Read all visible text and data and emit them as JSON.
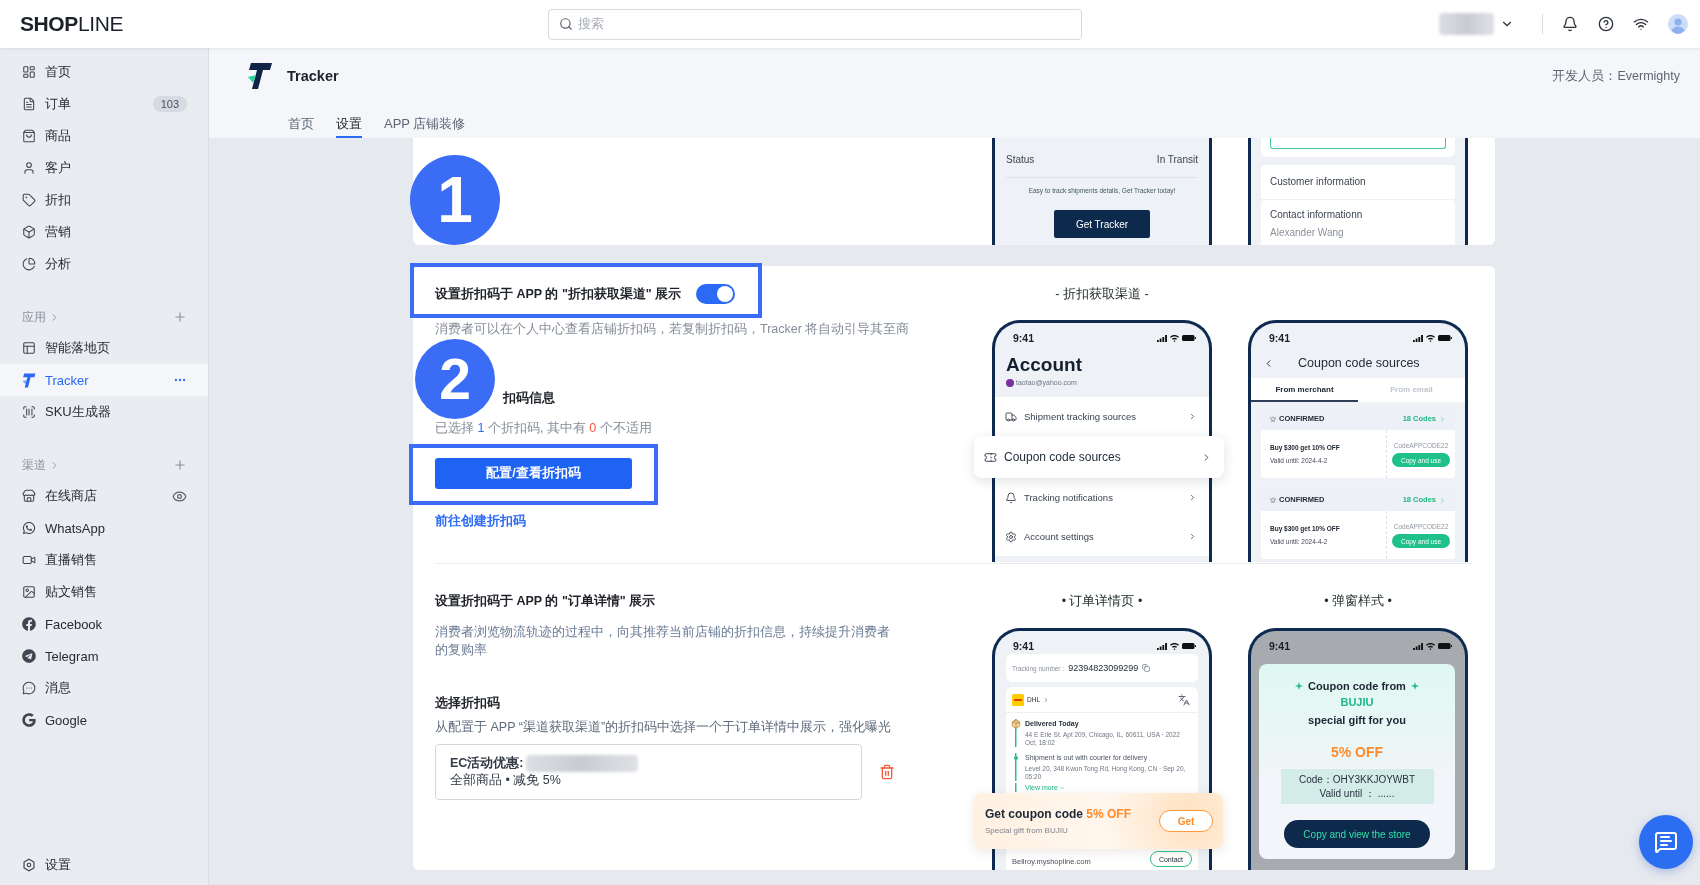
{
  "top_bar": {
    "logo": "**SHOP**LINE",
    "search": {
      "placeholder": "搜索"
    }
  },
  "sidebar": {
    "groups": [
      {
        "items": [
          {
            "label": "首页",
            "selected": false
          },
          {
            "label": "订单",
            "badge": "103",
            "selected": false
          },
          {
            "label": "商品",
            "selected": false
          },
          {
            "label": "客户",
            "selected": false
          },
          {
            "label": "折扣",
            "selected": false
          },
          {
            "label": "营销",
            "selected": false
          },
          {
            "label": "分析",
            "selected": false
          }
        ]
      },
      {
        "title": "应用",
        "items": [
          {
            "label": "智能落地页",
            "selected": false
          },
          {
            "label": "Tracker",
            "selected": true
          },
          {
            "label": "SKU生成器",
            "selected": false
          }
        ]
      },
      {
        "title": "渠道",
        "items": [
          {
            "label": "在线商店",
            "selected": false
          },
          {
            "label": "WhatsApp",
            "selected": false
          },
          {
            "label": "直播销售",
            "selected": false
          },
          {
            "label": "贴文销售",
            "selected": false
          },
          {
            "label": "Facebook",
            "selected": false
          },
          {
            "label": "Telegram",
            "selected": false
          },
          {
            "label": "消息",
            "selected": false
          },
          {
            "label": "Google",
            "selected": false
          }
        ]
      }
    ],
    "footer": {
      "label": "设置",
      "selected": false
    }
  },
  "app_header": {
    "name": "Tracker",
    "developer": "开发人员：Evermighty",
    "tabs": [
      {
        "label": "首页",
        "selected": false
      },
      {
        "label": "设置",
        "selected": true
      },
      {
        "label": "APP 店铺装修",
        "selected": false
      }
    ]
  },
  "top_card": {
    "marker": "1",
    "tracking_phone": {
      "status_label": "Status",
      "status_value": "In Transit",
      "tagline": "Easy to track shipments details, Get Tracker today!",
      "button": "Get Tracker"
    },
    "order_phone": {
      "rows": [
        {
          "title": "Customer information"
        },
        {
          "title": "Contact informationn",
          "value": "Alexander Wang"
        }
      ]
    }
  },
  "coupon_channel": {
    "marker": "2",
    "toggle": {
      "label": "设置折扣码于 APP 的 \"折扣获取渠道\" 展示",
      "on": true,
      "framed": true
    },
    "description": "消费者可以在个人中心查看店铺折扣码，若复制折扣码，Tracker 将自动引导其至商",
    "info_heading": "扣码信息",
    "summary": {
      "before": "已选择",
      "selected_count": "1",
      "middle": "个折扣码, 其中有",
      "invalid_count": "0",
      "after": "个不适用"
    },
    "button": {
      "label": "配置/查看折扣码",
      "framed": true
    },
    "link": "前往创建折扣码",
    "preview_caption": "- 折扣获取渠道 -",
    "account_phone": {
      "time": "9:41",
      "title": "Account",
      "email": "taotao@yahoo.com",
      "menu": [
        {
          "label": "Shipment tracking sources",
          "highlighted": false
        },
        {
          "label": "Coupon code sources",
          "highlighted": true
        },
        {
          "label": "Tracking notifications",
          "highlighted": false
        },
        {
          "label": "Account settings",
          "highlighted": false
        }
      ]
    },
    "sources_phone": {
      "time": "9:41",
      "title": "Coupon code sources",
      "tabs": [
        {
          "label": "From merchant",
          "selected": true
        },
        {
          "label": "From email",
          "selected": false
        }
      ],
      "coupons": [
        {
          "status": "CONFIRMED",
          "count": "18 Codes",
          "offer": "Buy $300 get 10% OFF",
          "valid": "Valid until: 2024-4-2",
          "code": "CodeAPPCODE22",
          "button": "Copy and use"
        },
        {
          "status": "CONFIRMED",
          "count": "18 Codes",
          "offer": "Buy $300 get 10% OFF",
          "valid": "Valid until: 2024-4-2",
          "code": "CodeAPPCODE22",
          "button": "Copy and use"
        }
      ]
    }
  },
  "order_detail": {
    "heading": "设置折扣码于 APP 的 \"订单详情\" 展示",
    "description": "消费者浏览物流轨迹的过程中，向其推荐当前店铺的折扣信息，持续提升消费者的复购率",
    "select_heading": "选择折扣码",
    "select_hint": "从配置于 APP “渠道获取渠道”的折扣码中选择一个于订单详情中展示，强化曝光",
    "coupon": {
      "title": "EC活动优惠:",
      "detail": "全部商品 • 减免 5%"
    },
    "detail_phone": {
      "caption": "• 订单详情页 •",
      "time": "9:41",
      "tracking_label": "Tracking number :",
      "tracking_number": "92394823099299",
      "carrier": "DHL",
      "events": [
        {
          "title": "Delivered Today",
          "detail": "44 E Erie St. Apt 209, Chicago, IL, 60611, USA · 2022 Oct, 18:02",
          "current": true
        },
        {
          "title": "Shipment is out with courier for delivery",
          "detail": "Level 20, 348 Kwun Tong Rd, Hong Kong, CN · Sep 20, 05:20",
          "current": false
        }
      ],
      "view_more": "View more",
      "banner": {
        "title": "Get coupon code",
        "offer": "5% OFF",
        "subtitle": "Special gift from BUJIU",
        "button": "Get"
      },
      "store": "Bellroy.myshopline.com",
      "contact": "Contact"
    },
    "popup_phone": {
      "caption": "• 弹窗样式 •",
      "time": "9:41",
      "heading": "Coupon code from",
      "brand": "BUJIU",
      "subheading": "special gift for you",
      "offer": "5% OFF",
      "code": "Code：OHY3KKJOYWBT",
      "valid": "Valid until ： ......",
      "button": "Copy and view the store"
    }
  }
}
